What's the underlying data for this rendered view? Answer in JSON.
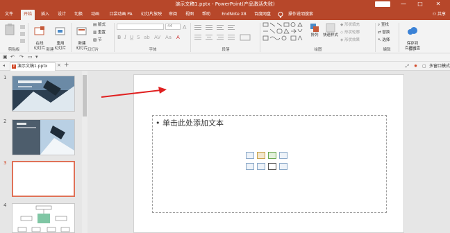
{
  "window": {
    "title": "演示文稿1.pptx  -  PowerPoint(产品激活失败)",
    "minimize": "—",
    "maximize": "□",
    "close": "✕"
  },
  "tabs": [
    {
      "label": "文件",
      "active": false
    },
    {
      "label": "开始",
      "active": true
    },
    {
      "label": "插入",
      "active": false
    },
    {
      "label": "设计",
      "active": false
    },
    {
      "label": "切换",
      "active": false
    },
    {
      "label": "动画",
      "active": false
    },
    {
      "label": "口袋动画 PA",
      "active": false
    },
    {
      "label": "幻灯片放映",
      "active": false
    },
    {
      "label": "审阅",
      "active": false
    },
    {
      "label": "视图",
      "active": false
    },
    {
      "label": "帮助",
      "active": false
    },
    {
      "label": "EndNote X8",
      "active": false
    },
    {
      "label": "百度网盘",
      "active": false
    },
    {
      "label": "操作说明搜索",
      "active": false
    }
  ],
  "share_label": "共享",
  "ribbon": {
    "clipboard": {
      "label": "剪贴板",
      "paste": "粘贴"
    },
    "slides": {
      "label": "幻灯片",
      "reuse": "重用\n幻灯片",
      "new_slide": "新建\n幻灯片",
      "layout": "版式",
      "reset": "重置",
      "section": "节"
    },
    "new": {
      "label": "新建",
      "add": "在线\n幻灯片"
    },
    "font": {
      "label": "字体",
      "size": "44"
    },
    "paragraph": {
      "label": "段落"
    },
    "drawing": {
      "label": "绘图",
      "arrange": "排列",
      "quick_styles": "快速样式",
      "fill": "形状填充",
      "outline": "形状轮廓",
      "effects": "形状效果"
    },
    "editing": {
      "label": "编辑",
      "find": "查找",
      "replace": "替换",
      "select": "选择"
    },
    "save": {
      "label": "保存",
      "baidu": "保存到\n百度网盘"
    }
  },
  "doc_tab": {
    "name": "演示文稿1.pptx",
    "close": "×",
    "add": "+"
  },
  "right_strip": {
    "label": "多窗口模式"
  },
  "thumbnails": [
    {
      "num": "1"
    },
    {
      "num": "2"
    },
    {
      "num": "3"
    },
    {
      "num": "4"
    }
  ],
  "slide": {
    "placeholder_text": "• 单击此处添加文本"
  },
  "colors": {
    "accent": "#b7472a",
    "arrow": "#e02020"
  }
}
